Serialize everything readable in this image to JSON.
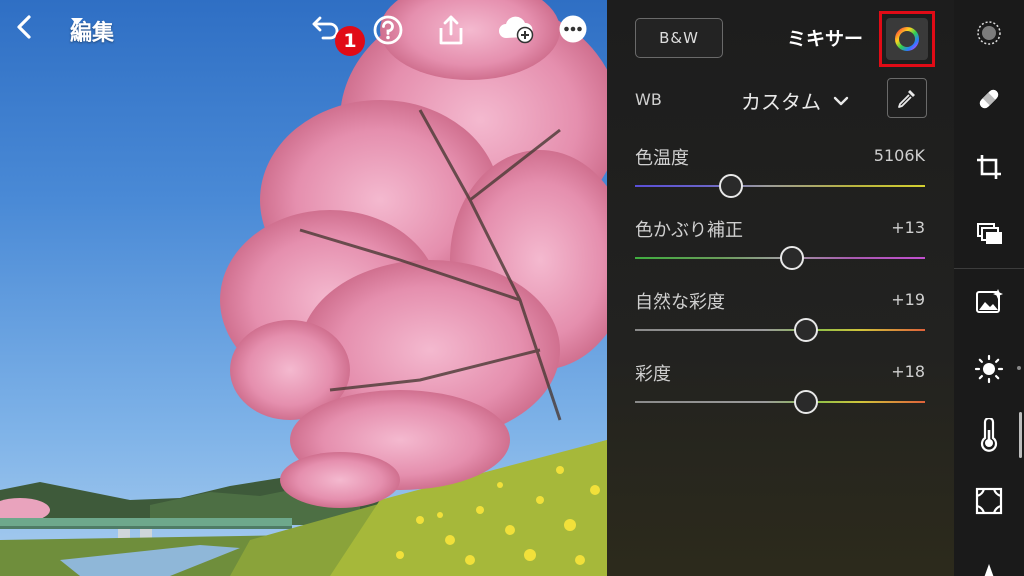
{
  "toolbar": {
    "edit_label": "編集"
  },
  "panel": {
    "bw_label": "B&W",
    "mixer_label": "ミキサー",
    "step_badge": "1",
    "wb_label": "WB",
    "wb_value": "カスタム",
    "sliders": [
      {
        "label": "色温度",
        "value": "5106K",
        "level": 0.33
      },
      {
        "label": "色かぶり補正",
        "value": "+13",
        "level": 0.54
      },
      {
        "label": "自然な彩度",
        "value": "+19",
        "level": 0.59
      },
      {
        "label": "彩度",
        "value": "+18",
        "level": 0.59
      }
    ]
  },
  "icons": {
    "top": [
      "back-icon",
      "dropdown-icon",
      "undo-icon",
      "help-icon",
      "share-icon",
      "cloud-add-icon",
      "more-icon"
    ],
    "tools": [
      "presets-icon",
      "healing-icon",
      "crop-icon",
      "versions-icon",
      "auto-icon",
      "light-icon",
      "color-icon",
      "effects-icon",
      "detail-icon"
    ]
  },
  "colors": {
    "accent_red": "#e10b16",
    "panel_bg": "#1e1e1e"
  }
}
